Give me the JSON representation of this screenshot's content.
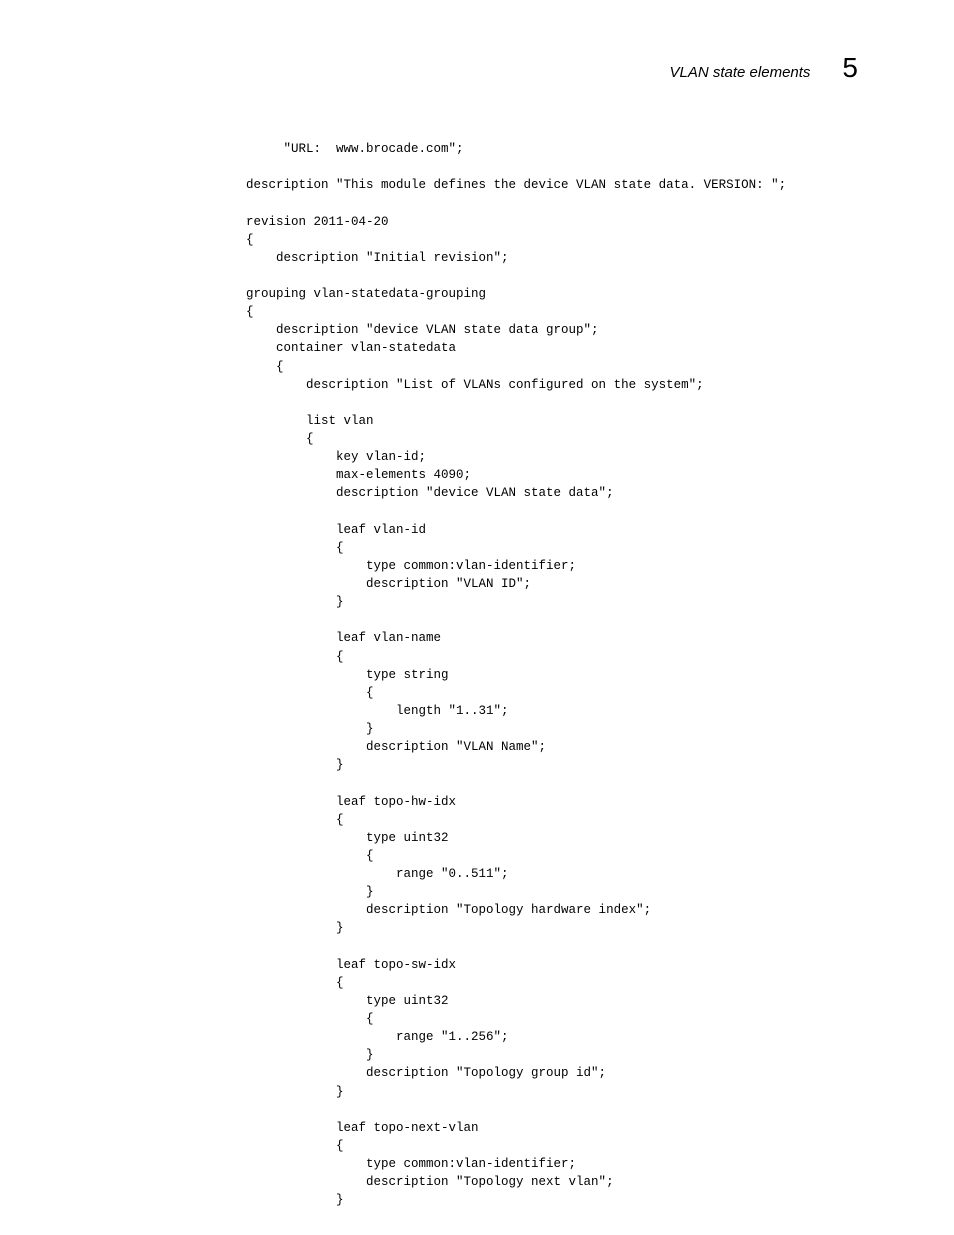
{
  "header": {
    "title": "VLAN state elements",
    "chapter": "5"
  },
  "code": "         \"URL:  www.brocade.com\";\n\n    description \"This module defines the device VLAN state data. VERSION: \";\n\n    revision 2011-04-20\n    {\n        description \"Initial revision\";\n\n    grouping vlan-statedata-grouping\n    {\n        description \"device VLAN state data group\";\n        container vlan-statedata\n        {\n            description \"List of VLANs configured on the system\";\n\n            list vlan\n            {\n                key vlan-id;\n                max-elements 4090;\n                description \"device VLAN state data\";\n\n                leaf vlan-id\n                {\n                    type common:vlan-identifier;\n                    description \"VLAN ID\";\n                }\n\n                leaf vlan-name\n                {\n                    type string\n                    {\n                        length \"1..31\";\n                    }\n                    description \"VLAN Name\";\n                }\n\n                leaf topo-hw-idx\n                {\n                    type uint32\n                    {\n                        range \"0..511\";\n                    }\n                    description \"Topology hardware index\";\n                }\n\n                leaf topo-sw-idx\n                {\n                    type uint32\n                    {\n                        range \"1..256\";\n                    }\n                    description \"Topology group id\";\n                }\n\n                leaf topo-next-vlan\n                {\n                    type common:vlan-identifier;\n                    description \"Topology next vlan\";\n                }",
  "chart_data": {
    "type": "none",
    "note": "This page contains no chart — it is a printed code/document page."
  }
}
